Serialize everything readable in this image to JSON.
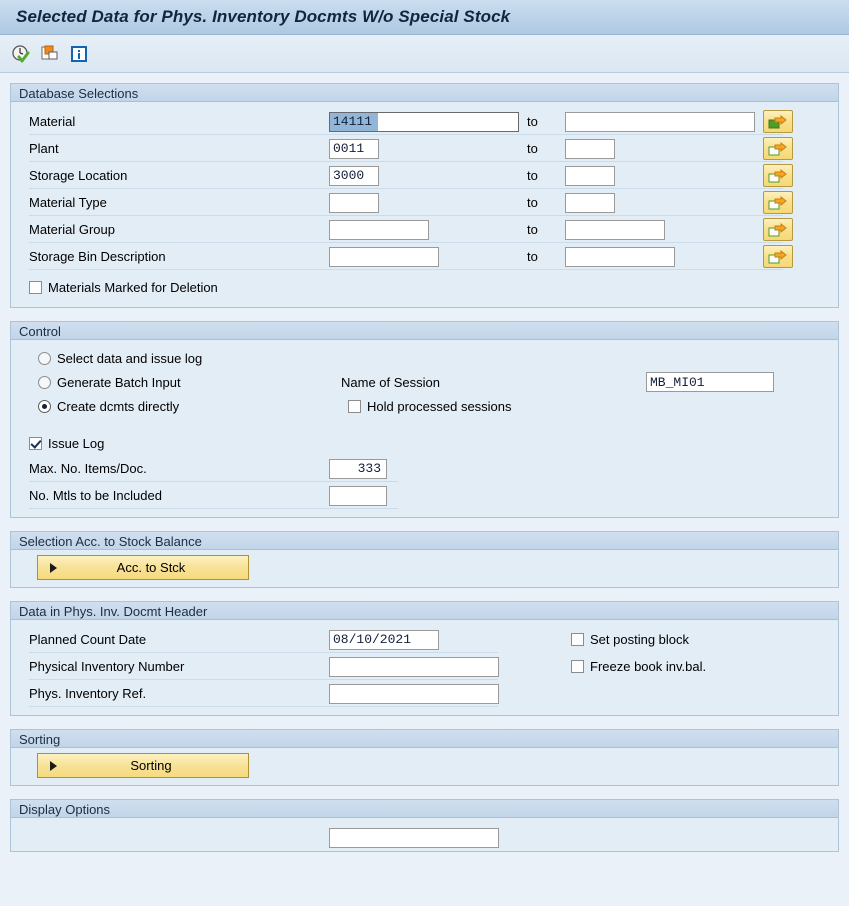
{
  "window": {
    "title": "Selected Data for Phys. Inventory Docmts W/o Special Stock"
  },
  "toolbar": {
    "icons": [
      {
        "name": "execute-clock-icon",
        "tooltip": "Execute"
      },
      {
        "name": "copy-multiple-selection-icon",
        "tooltip": "Multiple Selection"
      },
      {
        "name": "info-icon",
        "tooltip": "Information"
      }
    ]
  },
  "sections": {
    "database_selections": {
      "title": "Database Selections",
      "to_label": "to",
      "rows": [
        {
          "label": "Material",
          "from": "14111",
          "from_selected": true,
          "to": "",
          "from_width": 190,
          "to_width": 190,
          "sel_filled": true
        },
        {
          "label": "Plant",
          "from": "0011",
          "from_selected": false,
          "to": "",
          "from_width": 50,
          "to_width": 50,
          "sel_filled": false
        },
        {
          "label": "Storage Location",
          "from": "3000",
          "from_selected": false,
          "to": "",
          "from_width": 50,
          "to_width": 50,
          "sel_filled": false
        },
        {
          "label": "Material Type",
          "from": "",
          "from_selected": false,
          "to": "",
          "from_width": 50,
          "to_width": 50,
          "sel_filled": false
        },
        {
          "label": "Material Group",
          "from": "",
          "from_selected": false,
          "to": "",
          "from_width": 100,
          "to_width": 100,
          "sel_filled": false
        },
        {
          "label": "Storage Bin Description",
          "from": "",
          "from_selected": false,
          "to": "",
          "from_width": 110,
          "to_width": 110,
          "sel_filled": false
        }
      ],
      "deletion_checkbox": {
        "label": "Materials Marked for Deletion",
        "checked": false
      }
    },
    "control": {
      "title": "Control",
      "radios": [
        {
          "label": "Select data and issue log",
          "checked": false
        },
        {
          "label": "Generate Batch Input",
          "checked": false
        },
        {
          "label": "Create dcmts directly",
          "checked": true
        }
      ],
      "session_label": "Name of Session",
      "session_value": "MB_MI01",
      "hold_checkbox": {
        "label": "Hold processed sessions",
        "checked": false
      },
      "issue_log_checkbox": {
        "label": "Issue Log",
        "checked": true
      },
      "fields": [
        {
          "label": "Max. No. Items/Doc.",
          "value": "333"
        },
        {
          "label": "No. Mtls to be Included",
          "value": ""
        }
      ]
    },
    "stock_balance": {
      "title": "Selection Acc. to Stock Balance",
      "button_label": "Acc. to Stck"
    },
    "doc_header": {
      "title": "Data in Phys. Inv. Docmt Header",
      "rows": [
        {
          "label": "Planned Count Date",
          "value": "08/10/2021",
          "width": 110,
          "mono": true
        },
        {
          "label": "Physical Inventory Number",
          "value": "",
          "width": 170,
          "mono": false
        },
        {
          "label": "Phys. Inventory Ref.",
          "value": "",
          "width": 170,
          "mono": false
        }
      ],
      "checkboxes": [
        {
          "label": "Set posting block",
          "checked": false
        },
        {
          "label": "Freeze book inv.bal.",
          "checked": false
        }
      ]
    },
    "sorting": {
      "title": "Sorting",
      "button_label": "Sorting"
    },
    "display_options": {
      "title": "Display Options"
    }
  },
  "colors": {
    "title_bar": "#bcd3e9",
    "panel_bg": "#e3edf6",
    "section_header": "#c6d8ea",
    "accent_yellow": "#f8e297",
    "selection_blue": "#92b5d8"
  }
}
